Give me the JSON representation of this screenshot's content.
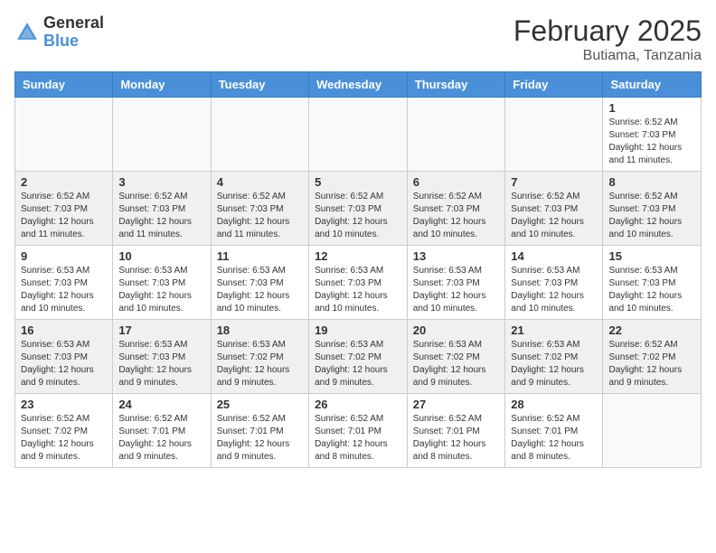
{
  "header": {
    "logo_general": "General",
    "logo_blue": "Blue",
    "month_title": "February 2025",
    "location": "Butiama, Tanzania"
  },
  "days_of_week": [
    "Sunday",
    "Monday",
    "Tuesday",
    "Wednesday",
    "Thursday",
    "Friday",
    "Saturday"
  ],
  "weeks": [
    [
      {
        "day": "",
        "info": ""
      },
      {
        "day": "",
        "info": ""
      },
      {
        "day": "",
        "info": ""
      },
      {
        "day": "",
        "info": ""
      },
      {
        "day": "",
        "info": ""
      },
      {
        "day": "",
        "info": ""
      },
      {
        "day": "1",
        "info": "Sunrise: 6:52 AM\nSunset: 7:03 PM\nDaylight: 12 hours\nand 11 minutes."
      }
    ],
    [
      {
        "day": "2",
        "info": "Sunrise: 6:52 AM\nSunset: 7:03 PM\nDaylight: 12 hours\nand 11 minutes."
      },
      {
        "day": "3",
        "info": "Sunrise: 6:52 AM\nSunset: 7:03 PM\nDaylight: 12 hours\nand 11 minutes."
      },
      {
        "day": "4",
        "info": "Sunrise: 6:52 AM\nSunset: 7:03 PM\nDaylight: 12 hours\nand 11 minutes."
      },
      {
        "day": "5",
        "info": "Sunrise: 6:52 AM\nSunset: 7:03 PM\nDaylight: 12 hours\nand 10 minutes."
      },
      {
        "day": "6",
        "info": "Sunrise: 6:52 AM\nSunset: 7:03 PM\nDaylight: 12 hours\nand 10 minutes."
      },
      {
        "day": "7",
        "info": "Sunrise: 6:52 AM\nSunset: 7:03 PM\nDaylight: 12 hours\nand 10 minutes."
      },
      {
        "day": "8",
        "info": "Sunrise: 6:52 AM\nSunset: 7:03 PM\nDaylight: 12 hours\nand 10 minutes."
      }
    ],
    [
      {
        "day": "9",
        "info": "Sunrise: 6:53 AM\nSunset: 7:03 PM\nDaylight: 12 hours\nand 10 minutes."
      },
      {
        "day": "10",
        "info": "Sunrise: 6:53 AM\nSunset: 7:03 PM\nDaylight: 12 hours\nand 10 minutes."
      },
      {
        "day": "11",
        "info": "Sunrise: 6:53 AM\nSunset: 7:03 PM\nDaylight: 12 hours\nand 10 minutes."
      },
      {
        "day": "12",
        "info": "Sunrise: 6:53 AM\nSunset: 7:03 PM\nDaylight: 12 hours\nand 10 minutes."
      },
      {
        "day": "13",
        "info": "Sunrise: 6:53 AM\nSunset: 7:03 PM\nDaylight: 12 hours\nand 10 minutes."
      },
      {
        "day": "14",
        "info": "Sunrise: 6:53 AM\nSunset: 7:03 PM\nDaylight: 12 hours\nand 10 minutes."
      },
      {
        "day": "15",
        "info": "Sunrise: 6:53 AM\nSunset: 7:03 PM\nDaylight: 12 hours\nand 10 minutes."
      }
    ],
    [
      {
        "day": "16",
        "info": "Sunrise: 6:53 AM\nSunset: 7:03 PM\nDaylight: 12 hours\nand 9 minutes."
      },
      {
        "day": "17",
        "info": "Sunrise: 6:53 AM\nSunset: 7:03 PM\nDaylight: 12 hours\nand 9 minutes."
      },
      {
        "day": "18",
        "info": "Sunrise: 6:53 AM\nSunset: 7:02 PM\nDaylight: 12 hours\nand 9 minutes."
      },
      {
        "day": "19",
        "info": "Sunrise: 6:53 AM\nSunset: 7:02 PM\nDaylight: 12 hours\nand 9 minutes."
      },
      {
        "day": "20",
        "info": "Sunrise: 6:53 AM\nSunset: 7:02 PM\nDaylight: 12 hours\nand 9 minutes."
      },
      {
        "day": "21",
        "info": "Sunrise: 6:53 AM\nSunset: 7:02 PM\nDaylight: 12 hours\nand 9 minutes."
      },
      {
        "day": "22",
        "info": "Sunrise: 6:52 AM\nSunset: 7:02 PM\nDaylight: 12 hours\nand 9 minutes."
      }
    ],
    [
      {
        "day": "23",
        "info": "Sunrise: 6:52 AM\nSunset: 7:02 PM\nDaylight: 12 hours\nand 9 minutes."
      },
      {
        "day": "24",
        "info": "Sunrise: 6:52 AM\nSunset: 7:01 PM\nDaylight: 12 hours\nand 9 minutes."
      },
      {
        "day": "25",
        "info": "Sunrise: 6:52 AM\nSunset: 7:01 PM\nDaylight: 12 hours\nand 9 minutes."
      },
      {
        "day": "26",
        "info": "Sunrise: 6:52 AM\nSunset: 7:01 PM\nDaylight: 12 hours\nand 8 minutes."
      },
      {
        "day": "27",
        "info": "Sunrise: 6:52 AM\nSunset: 7:01 PM\nDaylight: 12 hours\nand 8 minutes."
      },
      {
        "day": "28",
        "info": "Sunrise: 6:52 AM\nSunset: 7:01 PM\nDaylight: 12 hours\nand 8 minutes."
      },
      {
        "day": "",
        "info": ""
      }
    ]
  ]
}
